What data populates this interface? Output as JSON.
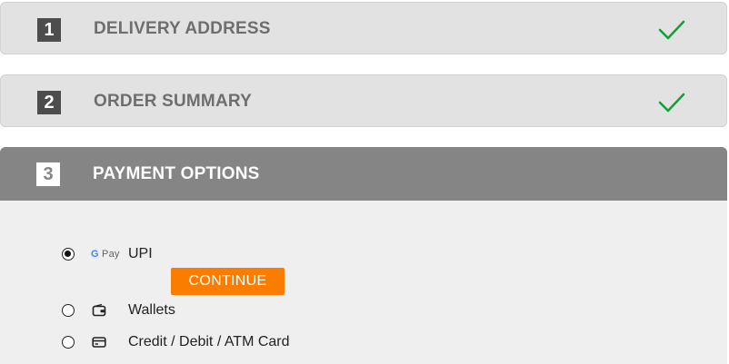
{
  "steps": [
    {
      "number": "1",
      "title": "DELIVERY ADDRESS",
      "status": "completed"
    },
    {
      "number": "2",
      "title": "ORDER SUMMARY",
      "status": "completed"
    },
    {
      "number": "3",
      "title": "PAYMENT OPTIONS",
      "status": "active"
    }
  ],
  "payment": {
    "options": [
      {
        "icon": "google-pay-icon",
        "brand_prefix": "G",
        "brand_text": "Pay",
        "label": "UPI",
        "selected": true
      },
      {
        "icon": "wallet-icon",
        "label": "Wallets",
        "selected": false
      },
      {
        "icon": "credit-card-icon",
        "label": "Credit / Debit / ATM Card",
        "selected": false
      }
    ],
    "continue_label": "CONTINUE"
  },
  "colors": {
    "check": "#1a9c3a",
    "continue_button": "#fb7d00",
    "active_header": "#858585",
    "inactive_header": "#e2e2e2"
  }
}
